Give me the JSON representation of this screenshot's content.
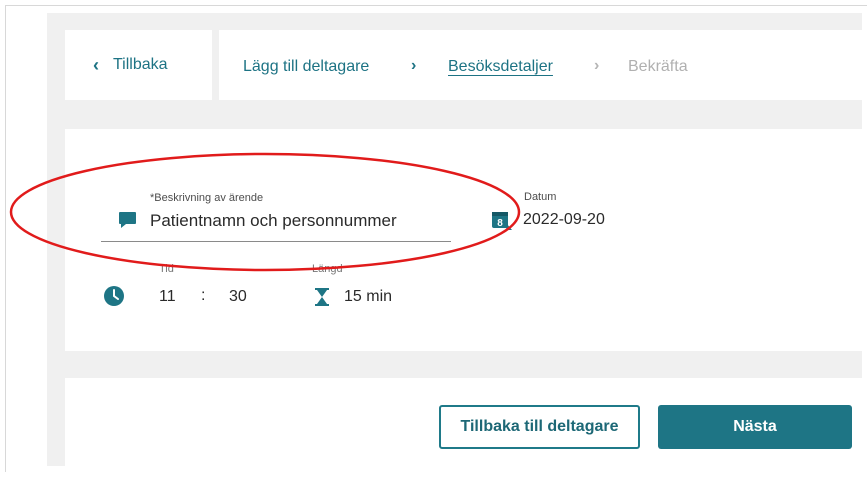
{
  "nav": {
    "back_label": "Tillbaka",
    "steps": [
      "Lägg till deltagare",
      "Besöksdetaljer",
      "Bekräfta"
    ],
    "active_step": "Besöksdetaljer"
  },
  "form": {
    "description": {
      "label": "*Beskrivning av ärende",
      "value": "Patientnamn och personnummer",
      "icon": "comment-icon"
    },
    "date": {
      "label": "Datum",
      "value": "2022-09-20",
      "icon": "calendar-icon",
      "calendar_day": "8"
    },
    "time": {
      "label": "Tid",
      "hour": "11",
      "separator": ":",
      "minute": "30",
      "icon": "clock-icon"
    },
    "length": {
      "label": "Längd",
      "value": "15 min",
      "icon": "hourglass-icon"
    }
  },
  "footer": {
    "secondary_button": "Tillbaka till deltagare",
    "primary_button": "Nästa"
  },
  "colors": {
    "accent": "#1e7585",
    "annotation": "#e11b1b",
    "background": "#f0f0f0"
  }
}
